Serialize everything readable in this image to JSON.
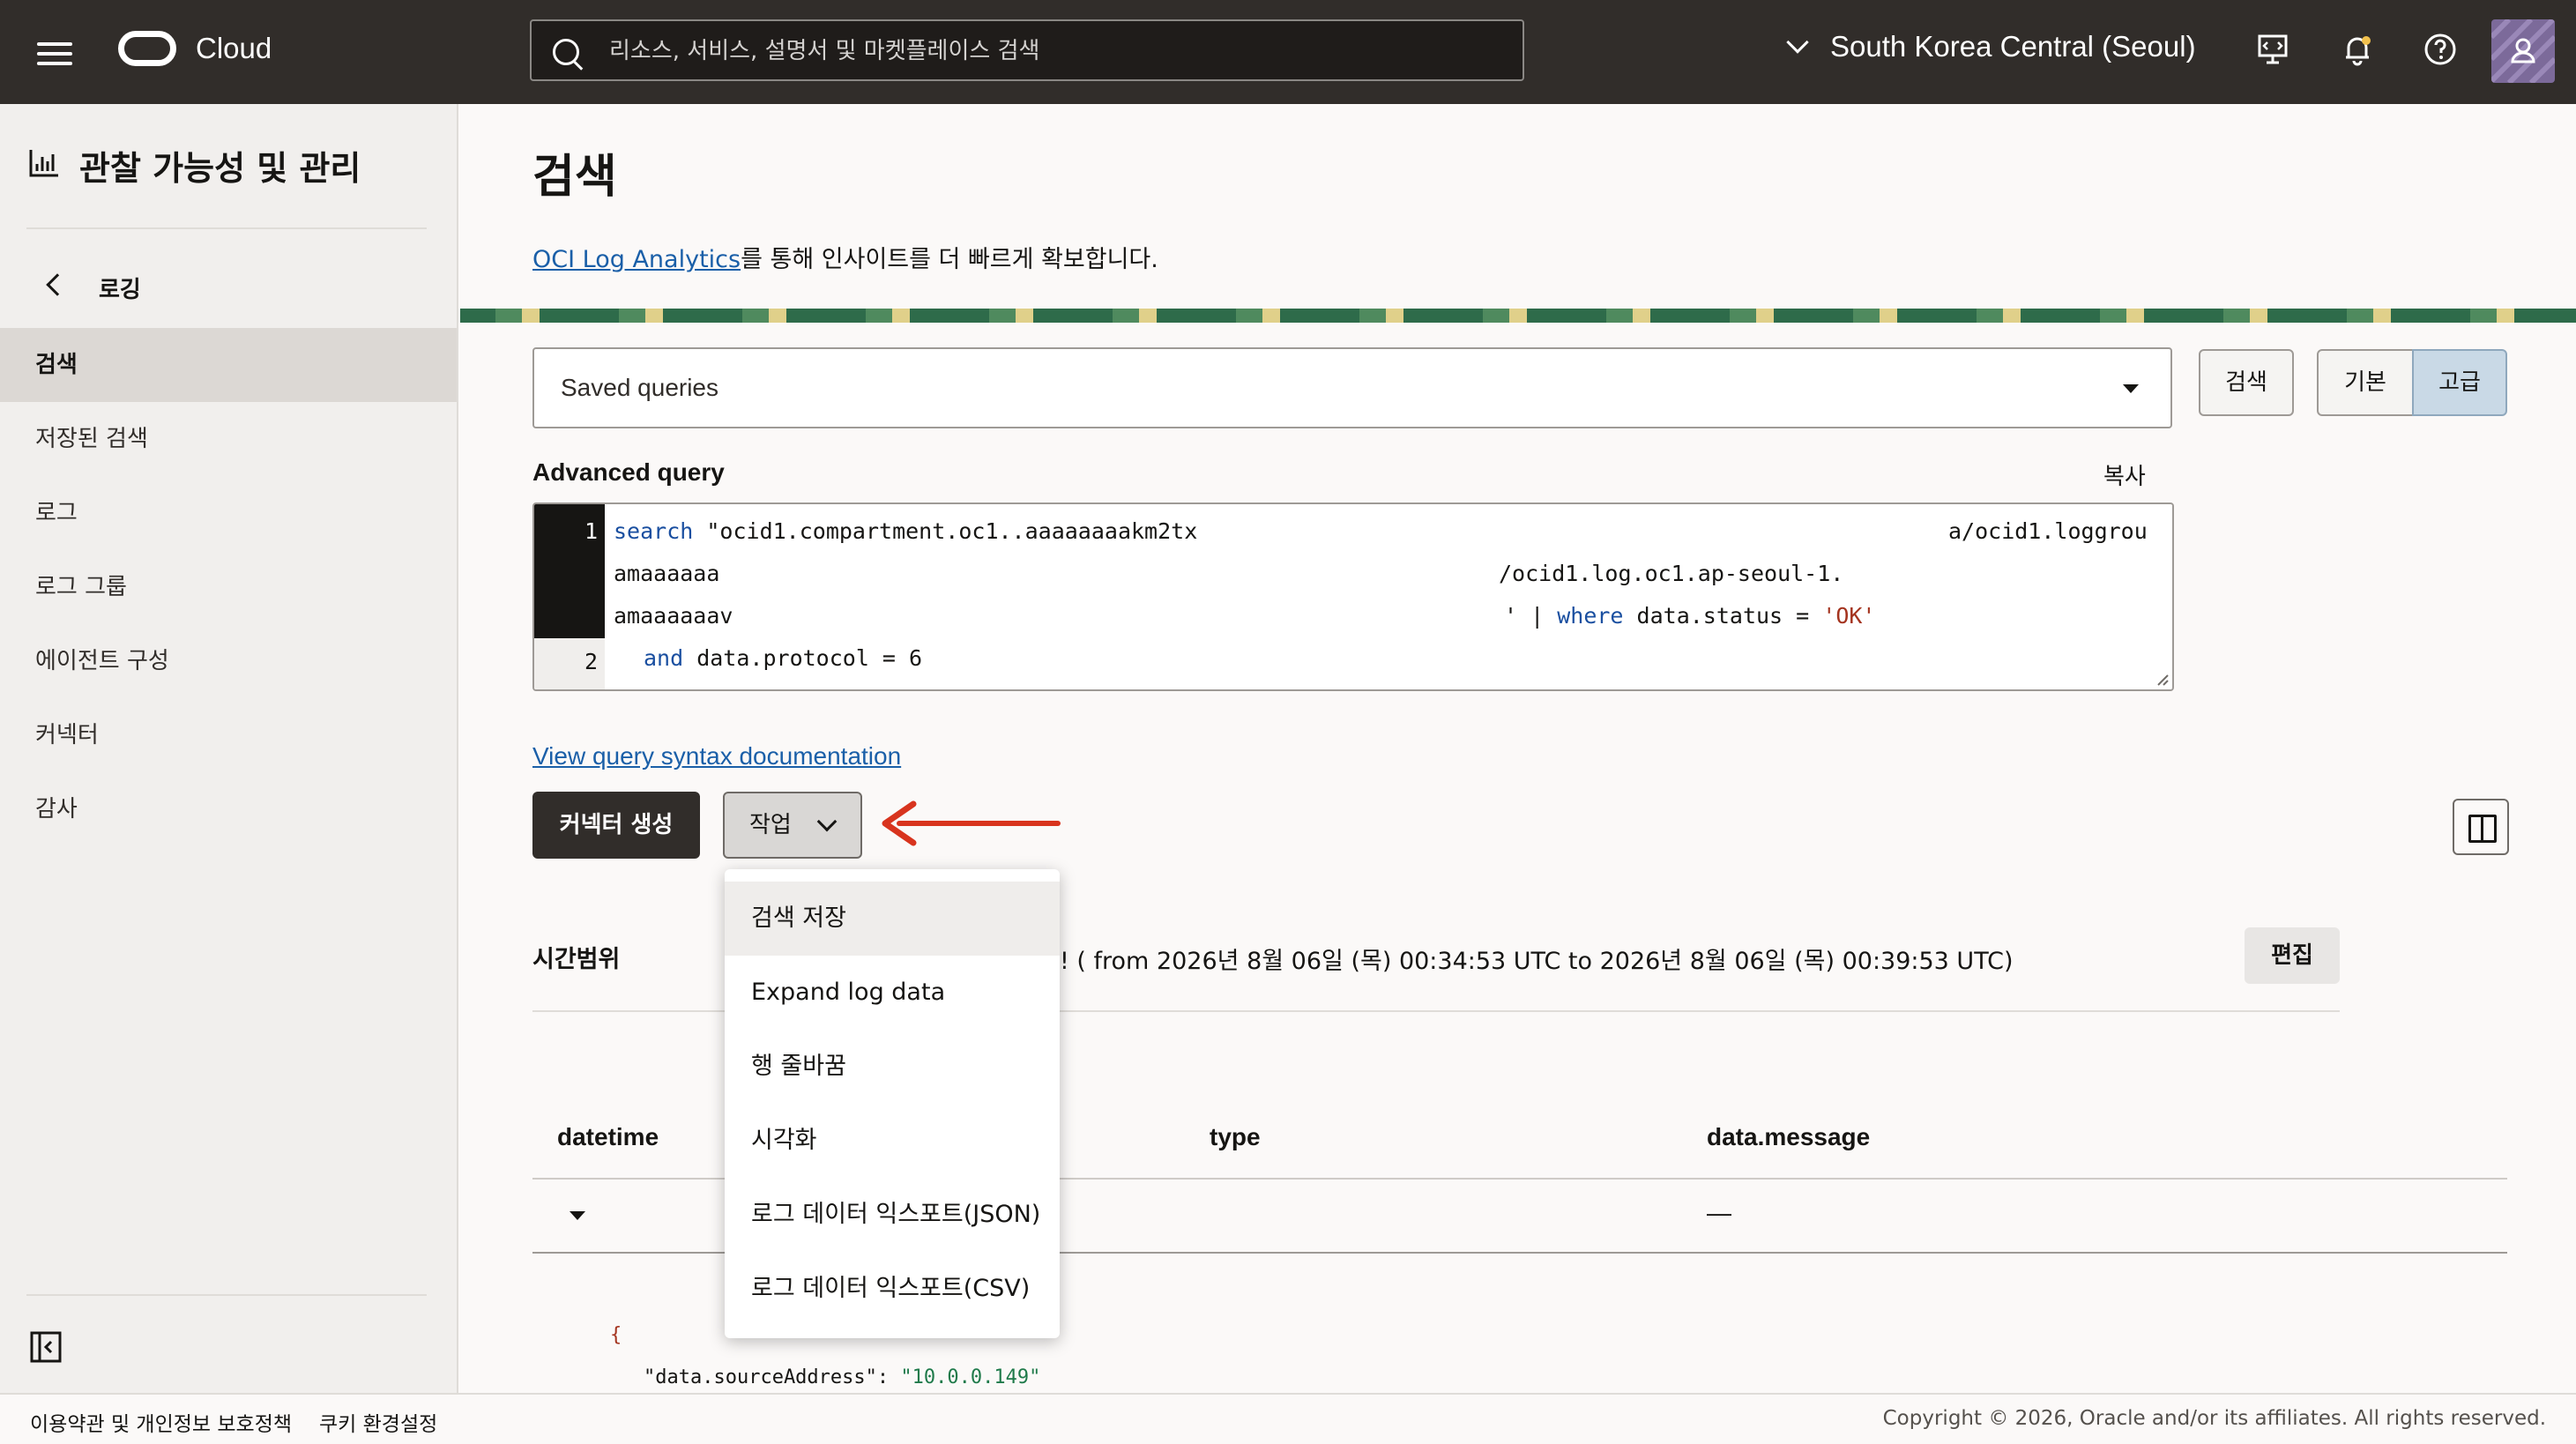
{
  "header": {
    "brand": "Cloud",
    "search_placeholder": "리소스, 서비스, 설명서 및 마켓플레이스 검색",
    "region": "South Korea Central (Seoul)"
  },
  "sidebar": {
    "title": "관찰 가능성 및 관리",
    "back_label": "로깅",
    "items": [
      {
        "label": "검색"
      },
      {
        "label": "저장된 검색"
      },
      {
        "label": "로그"
      },
      {
        "label": "로그 그룹"
      },
      {
        "label": "에이전트 구성"
      },
      {
        "label": "커넥터"
      },
      {
        "label": "감사"
      }
    ]
  },
  "main": {
    "title": "검색",
    "intro_link": "OCI Log Analytics",
    "intro_text": "를 통해 인사이트를 더 빠르게 확보합니다.",
    "saved_queries": "Saved queries",
    "search_button": "검색",
    "mode_basic": "기본",
    "mode_advanced": "고급",
    "advanced_query_label": "Advanced query",
    "copy_label": "복사",
    "query": {
      "line1_num": "1",
      "line2_num": "2",
      "l1_kw": "search",
      "l1_text": " \"ocid1.compartment.oc1..aaaaaaaakm2tx",
      "l1_tail": "a/ocid1.loggrou",
      "l2_text": "amaaaaaa",
      "l2_tail": "/ocid1.log.oc1.ap-seoul-1.",
      "l3_text": "amaaaaaav",
      "l3_tail1": "' | ",
      "l3_kw": "where",
      "l3_tail2": " data.status = ",
      "l3_str": "'OK'",
      "l4_kw": "and",
      "l4_text": " data.protocol = 6"
    },
    "doc_link": "View query syntax documentation",
    "create_connector_button": "커넥터 생성",
    "actions_button": "작업",
    "actions_menu": [
      {
        "label": "검색 저장"
      },
      {
        "label": "Expand log data"
      },
      {
        "label": "행 줄바꿈"
      },
      {
        "label": "시각화"
      },
      {
        "label": "로그 데이터 익스포트(JSON)"
      },
      {
        "label": "로그 데이터 익스포트(CSV)"
      }
    ],
    "time_range_label": "시간범위",
    "time_range_text": "! ( from 2026년 8월 06일 (목) 00:34:53 UTC to 2026년 8월 06일 (목) 00:39:53 UTC)",
    "edit_button": "편집",
    "columns": [
      "datetime",
      "type",
      "data.message"
    ],
    "row_message": "—",
    "json_open": "{",
    "json_key": "\"data.sourceAddress\"",
    "json_sep": ": ",
    "json_value": "\"10.0.0.149\""
  },
  "footer": {
    "terms": "이용약관 및 개인정보 보호정책",
    "cookies": "쿠키 환경설정",
    "copyright": "Copyright © 2026, Oracle and/or its affiliates. All rights reserved."
  },
  "colors": {
    "header_bg": "#312d2a",
    "link": "#1a5fa8",
    "annotation_arrow": "#d8341e"
  }
}
